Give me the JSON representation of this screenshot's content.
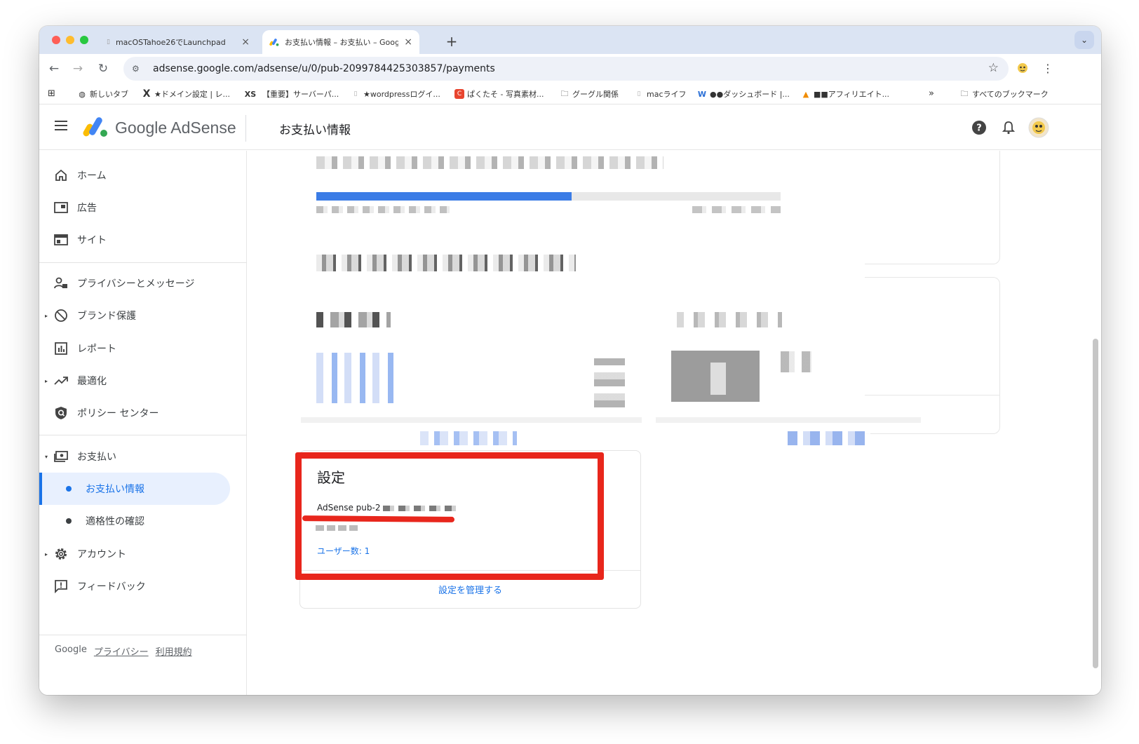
{
  "browser": {
    "tabs": [
      {
        "title": "macOSTahoe26でLaunchpad",
        "active": false
      },
      {
        "title": "お支払い情報 – お支払い – Goog",
        "active": true
      }
    ],
    "url": "adsense.google.com/adsense/u/0/pub-2099784425303857/payments"
  },
  "bookmarks": [
    {
      "label": "新しいタブ",
      "icon": "globe-icon"
    },
    {
      "label": "★ドメイン設定 | レ...",
      "icon": "x-logo-icon"
    },
    {
      "label": "【重要】サーバーパ...",
      "icon": "xs-logo-icon"
    },
    {
      "label": "★wordpressログイ...",
      "icon": "page-icon"
    },
    {
      "label": "ぱくたそ - 写真素材...",
      "icon": "pakutaso-icon"
    },
    {
      "label": "グーグル関係",
      "icon": "folder-icon"
    },
    {
      "label": "macライフ",
      "icon": "page-icon"
    },
    {
      "label": "●●ダッシュボード |...",
      "icon": "dashboard-icon"
    },
    {
      "label": "■■アフィリエイト...",
      "icon": "affiliate-icon"
    },
    {
      "label": "すべてのブックマーク",
      "icon": "folder-icon"
    }
  ],
  "header": {
    "brand_google": "Google",
    "brand_product": "AdSense",
    "page_title": "お支払い情報"
  },
  "sidebar": {
    "items": [
      {
        "label": "ホーム",
        "icon": "home-icon"
      },
      {
        "label": "広告",
        "icon": "ads-icon"
      },
      {
        "label": "サイト",
        "icon": "sites-icon"
      },
      {
        "label": "プライバシーとメッセージ",
        "icon": "privacy-icon"
      },
      {
        "label": "ブランド保護",
        "icon": "block-icon"
      },
      {
        "label": "レポート",
        "icon": "reports-icon"
      },
      {
        "label": "最適化",
        "icon": "trending-icon"
      },
      {
        "label": "ポリシー センター",
        "icon": "policy-icon"
      },
      {
        "label": "お支払い",
        "icon": "payments-icon"
      },
      {
        "label": "アカウント",
        "icon": "gear-icon"
      },
      {
        "label": "フィードバック",
        "icon": "feedback-icon"
      }
    ],
    "sub_items": [
      {
        "label": "お支払い情報",
        "active": true
      },
      {
        "label": "適格性の確認",
        "active": false
      }
    ],
    "footer": {
      "google": "Google",
      "privacy": "プライバシー",
      "terms": "利用規約"
    }
  },
  "main": {
    "payment_progress": 0.55,
    "settings": {
      "title": "設定",
      "pub_prefix": "AdSense pub-2",
      "users_link": "ユーザー数: 1",
      "manage_link": "設定を管理する"
    }
  },
  "colors": {
    "accent": "#1a73e8",
    "progress": "#3b7ce6",
    "annotation_red": "#e8261c",
    "tabstrip": "#dbe4f3"
  }
}
